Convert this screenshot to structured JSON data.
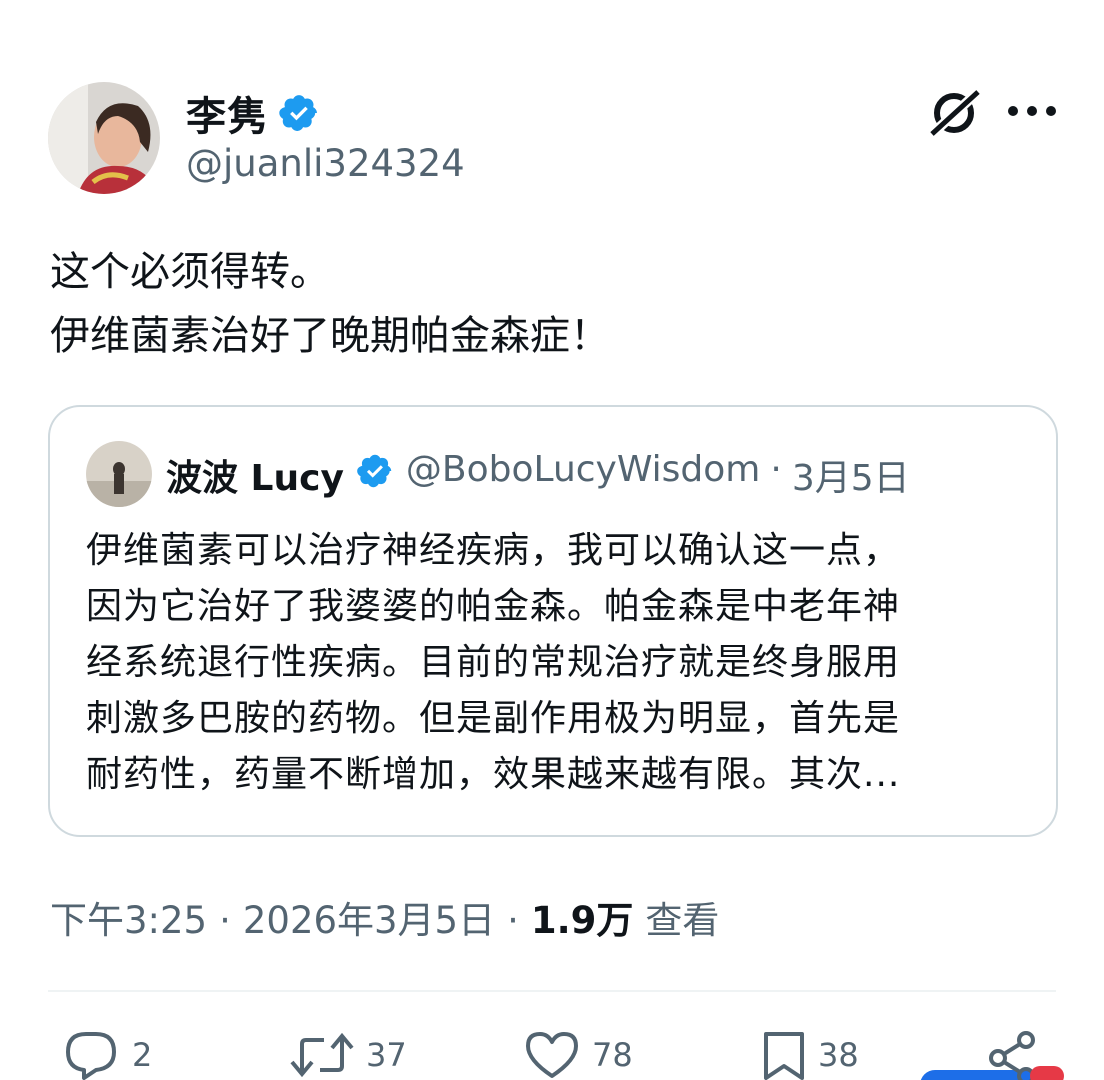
{
  "tweet": {
    "author": {
      "display_name": "李隽",
      "handle": "@juanli324324",
      "verified": true
    },
    "text_lines": [
      "这个必须得转。",
      "伊维菌素治好了晚期帕金森症！"
    ],
    "quoted": {
      "display_name": "波波 Lucy",
      "handle": "@BoboLucyWisdom",
      "separator": "·",
      "date": "3月5日",
      "verified": true,
      "text_lines": [
        "伊维菌素可以治疗神经疾病，我可以确认这一点，",
        "因为它治好了我婆婆的帕金森。帕金森是中老年神",
        "经系统退行性疾病。目前的常规治疗就是终身服用",
        "刺激多巴胺的药物。但是副作用极为明显，首先是",
        "耐药性，药量不断增加，效果越来越有限。其次..."
      ]
    },
    "meta": {
      "time": "下午3:25",
      "sep1": "·",
      "date": "2026年3月5日",
      "sep2": "·",
      "views_count": "1.9万",
      "views_label": "查看"
    },
    "actions": {
      "replies": "2",
      "reposts": "37",
      "likes": "78",
      "bookmarks": "38"
    }
  },
  "icons": {
    "verified": "verified-badge-icon",
    "grok": "grok-icon",
    "more": "more-dots-icon",
    "reply": "reply-icon",
    "repost": "repost-icon",
    "like": "heart-icon",
    "bookmark": "bookmark-icon",
    "share": "share-icon"
  },
  "colors": {
    "verified_blue": "#1d9bf0",
    "secondary_text": "#536471",
    "primary_text": "#0f1419",
    "border": "#cfd9de"
  }
}
